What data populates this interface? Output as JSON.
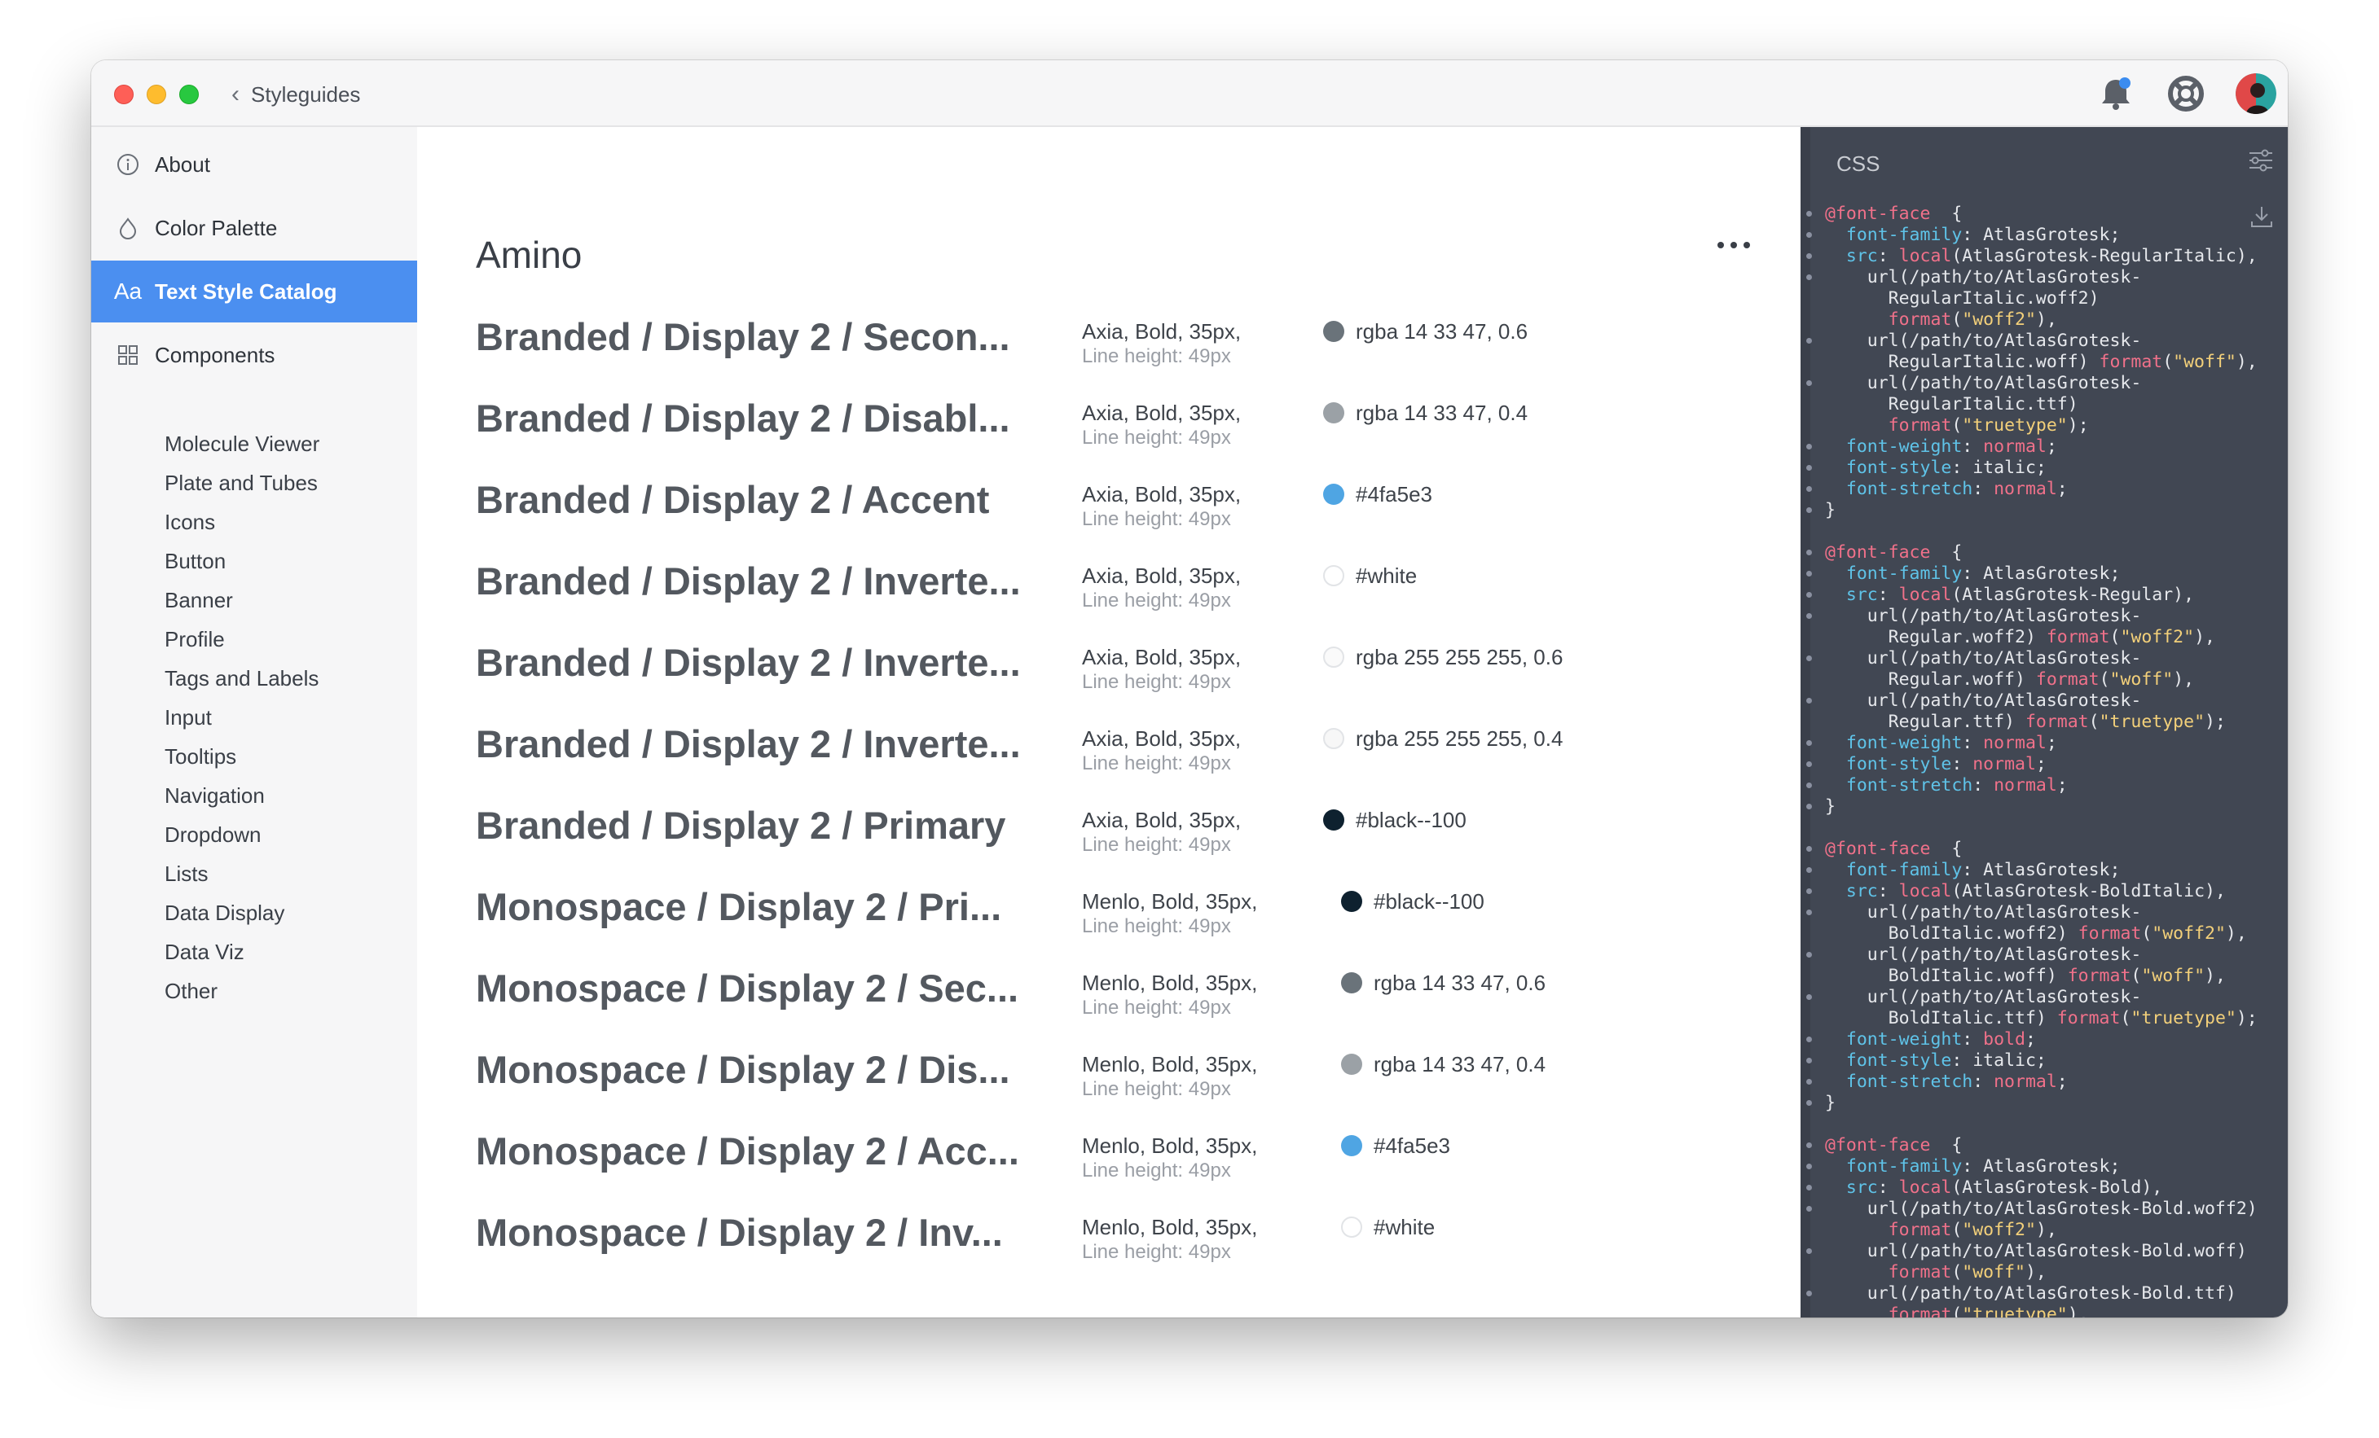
{
  "titlebar": {
    "back_label": "Styleguides",
    "icons": [
      "bell-icon",
      "help-lifebuoy-icon",
      "user-avatar"
    ]
  },
  "sidebar": {
    "top_items": [
      {
        "label": "About",
        "icon": "info-circle-icon",
        "active": false
      },
      {
        "label": "Color Palette",
        "icon": "drop-icon",
        "active": false
      },
      {
        "label": "Text Style Catalog",
        "icon": "text-aa-icon",
        "active": true
      },
      {
        "label": "Components",
        "icon": "grid-icon",
        "active": false
      }
    ],
    "components": [
      "Molecule Viewer",
      "Plate and Tubes",
      "Icons",
      "Button",
      "Banner",
      "Profile",
      "Tags and Labels",
      "Input",
      "Tooltips",
      "Navigation",
      "Dropdown",
      "Lists",
      "Data Display",
      "Data Viz",
      "Other"
    ]
  },
  "main": {
    "title": "Amino",
    "rows": [
      {
        "name": "Branded / Display 2 / Secon...",
        "props": "Axia, Bold, 35px,",
        "line_height": "Line height: 49px",
        "color": "rgba 14 33 47, 0.6",
        "swatch": "#6a737a"
      },
      {
        "name": "Branded / Display 2 / Disabl...",
        "props": "Axia, Bold, 35px,",
        "line_height": "Line height: 49px",
        "color": "rgba 14 33 47, 0.4",
        "swatch": "#9ba1a6"
      },
      {
        "name": "Branded / Display 2 / Accent",
        "props": "Axia, Bold, 35px,",
        "line_height": "Line height: 49px",
        "color": "#4fa5e3",
        "swatch": "#4fa5e3"
      },
      {
        "name": "Branded / Display 2 / Inverte...",
        "props": "Axia, Bold, 35px,",
        "line_height": "Line height: 49px",
        "color": "#white",
        "swatch": "#ffffff"
      },
      {
        "name": "Branded / Display 2 / Inverte...",
        "props": "Axia, Bold, 35px,",
        "line_height": "Line height: 49px",
        "color": "rgba 255 255 255, 0.6",
        "swatch": "#fafafa"
      },
      {
        "name": "Branded / Display 2 / Inverte...",
        "props": "Axia, Bold, 35px,",
        "line_height": "Line height: 49px",
        "color": "rgba 255 255 255, 0.4",
        "swatch": "#f7f7f7"
      },
      {
        "name": "Branded  / Display 2 / Primary",
        "props": "Axia, Bold, 35px,",
        "line_height": "Line height: 49px",
        "color": "#black--100",
        "swatch": "#0e212f"
      },
      {
        "name": "Monospace  / Display 2 / Pri...",
        "props": "Menlo, Bold, 35px,",
        "line_height": "Line height: 49px",
        "color": "#black--100",
        "swatch": "#0e212f"
      },
      {
        "name": "Monospace / Display 2 / Sec...",
        "props": "Menlo, Bold, 35px,",
        "line_height": "Line height: 49px",
        "color": "rgba 14 33 47, 0.6",
        "swatch": "#6a737a"
      },
      {
        "name": "Monospace / Display 2 / Dis...",
        "props": "Menlo, Bold, 35px,",
        "line_height": "Line height: 49px",
        "color": "rgba 14 33 47, 0.4",
        "swatch": "#9ba1a6"
      },
      {
        "name": "Monospace / Display 2 / Acc...",
        "props": "Menlo, Bold, 35px,",
        "line_height": "Line height: 49px",
        "color": "#4fa5e3",
        "swatch": "#4fa5e3"
      },
      {
        "name": "Monospace / Display 2 / Inv...",
        "props": "Menlo, Bold, 35px,",
        "line_height": "Line height: 49px",
        "color": "#white",
        "swatch": "#ffffff"
      }
    ]
  },
  "code_panel": {
    "title": "CSS",
    "lines": [
      [
        [
          "k",
          "@font-face"
        ],
        [
          "",
          "  {"
        ]
      ],
      [
        [
          "p",
          "  font-family"
        ],
        [
          "",
          ": AtlasGrotesk;"
        ]
      ],
      [
        [
          "p",
          "  src"
        ],
        [
          "",
          ": "
        ],
        [
          "k",
          "local"
        ],
        [
          "",
          "(AtlasGrotesk-RegularItalic),"
        ]
      ],
      [
        [
          "",
          "    url(/path/to/AtlasGrotesk-"
        ]
      ],
      [
        [
          "",
          "      RegularItalic.woff2)"
        ]
      ],
      [
        [
          "k",
          "      format"
        ],
        [
          "",
          "("
        ],
        [
          "s",
          "\"woff2\""
        ],
        [
          "",
          "),"
        ]
      ],
      [
        [
          "",
          "    url(/path/to/AtlasGrotesk-"
        ]
      ],
      [
        [
          "",
          "      RegularItalic.woff) "
        ],
        [
          "k",
          "format"
        ],
        [
          "",
          "("
        ],
        [
          "s",
          "\"woff\""
        ],
        [
          "",
          "),"
        ]
      ],
      [
        [
          "",
          "    url(/path/to/AtlasGrotesk-"
        ]
      ],
      [
        [
          "",
          "      RegularItalic.ttf)"
        ]
      ],
      [
        [
          "k",
          "      format"
        ],
        [
          "",
          "("
        ],
        [
          "s",
          "\"truetype\""
        ],
        [
          "",
          ");"
        ]
      ],
      [
        [
          "p",
          "  font-weight"
        ],
        [
          "",
          ": "
        ],
        [
          "k",
          "normal"
        ],
        [
          "",
          ";"
        ]
      ],
      [
        [
          "p",
          "  font-style"
        ],
        [
          "",
          ": italic;"
        ]
      ],
      [
        [
          "p",
          "  font-stretch"
        ],
        [
          "",
          ": "
        ],
        [
          "k",
          "normal"
        ],
        [
          "",
          ";"
        ]
      ],
      [
        [
          "",
          "}"
        ]
      ],
      [
        [
          "",
          ""
        ]
      ],
      [
        [
          "k",
          "@font-face"
        ],
        [
          "",
          "  {"
        ]
      ],
      [
        [
          "p",
          "  font-family"
        ],
        [
          "",
          ": AtlasGrotesk;"
        ]
      ],
      [
        [
          "p",
          "  src"
        ],
        [
          "",
          ": "
        ],
        [
          "k",
          "local"
        ],
        [
          "",
          "(AtlasGrotesk-Regular),"
        ]
      ],
      [
        [
          "",
          "    url(/path/to/AtlasGrotesk-"
        ]
      ],
      [
        [
          "",
          "      Regular.woff2) "
        ],
        [
          "k",
          "format"
        ],
        [
          "",
          "("
        ],
        [
          "s",
          "\"woff2\""
        ],
        [
          "",
          "),"
        ]
      ],
      [
        [
          "",
          "    url(/path/to/AtlasGrotesk-"
        ]
      ],
      [
        [
          "",
          "      Regular.woff) "
        ],
        [
          "k",
          "format"
        ],
        [
          "",
          "("
        ],
        [
          "s",
          "\"woff\""
        ],
        [
          "",
          "),"
        ]
      ],
      [
        [
          "",
          "    url(/path/to/AtlasGrotesk-"
        ]
      ],
      [
        [
          "",
          "      Regular.ttf) "
        ],
        [
          "k",
          "format"
        ],
        [
          "",
          "("
        ],
        [
          "s",
          "\"truetype\""
        ],
        [
          "",
          ");"
        ]
      ],
      [
        [
          "p",
          "  font-weight"
        ],
        [
          "",
          ": "
        ],
        [
          "k",
          "normal"
        ],
        [
          "",
          ";"
        ]
      ],
      [
        [
          "p",
          "  font-style"
        ],
        [
          "",
          ": "
        ],
        [
          "k",
          "normal"
        ],
        [
          "",
          ";"
        ]
      ],
      [
        [
          "p",
          "  font-stretch"
        ],
        [
          "",
          ": "
        ],
        [
          "k",
          "normal"
        ],
        [
          "",
          ";"
        ]
      ],
      [
        [
          "",
          "}"
        ]
      ],
      [
        [
          "",
          ""
        ]
      ],
      [
        [
          "k",
          "@font-face"
        ],
        [
          "",
          "  {"
        ]
      ],
      [
        [
          "p",
          "  font-family"
        ],
        [
          "",
          ": AtlasGrotesk;"
        ]
      ],
      [
        [
          "p",
          "  src"
        ],
        [
          "",
          ": "
        ],
        [
          "k",
          "local"
        ],
        [
          "",
          "(AtlasGrotesk-BoldItalic),"
        ]
      ],
      [
        [
          "",
          "    url(/path/to/AtlasGrotesk-"
        ]
      ],
      [
        [
          "",
          "      BoldItalic.woff2) "
        ],
        [
          "k",
          "format"
        ],
        [
          "",
          "("
        ],
        [
          "s",
          "\"woff2\""
        ],
        [
          "",
          "),"
        ]
      ],
      [
        [
          "",
          "    url(/path/to/AtlasGrotesk-"
        ]
      ],
      [
        [
          "",
          "      BoldItalic.woff) "
        ],
        [
          "k",
          "format"
        ],
        [
          "",
          "("
        ],
        [
          "s",
          "\"woff\""
        ],
        [
          "",
          "),"
        ]
      ],
      [
        [
          "",
          "    url(/path/to/AtlasGrotesk-"
        ]
      ],
      [
        [
          "",
          "      BoldItalic.ttf) "
        ],
        [
          "k",
          "format"
        ],
        [
          "",
          "("
        ],
        [
          "s",
          "\"truetype\""
        ],
        [
          "",
          ");"
        ]
      ],
      [
        [
          "p",
          "  font-weight"
        ],
        [
          "",
          ": "
        ],
        [
          "k",
          "bold"
        ],
        [
          "",
          ";"
        ]
      ],
      [
        [
          "p",
          "  font-style"
        ],
        [
          "",
          ": italic;"
        ]
      ],
      [
        [
          "p",
          "  font-stretch"
        ],
        [
          "",
          ": "
        ],
        [
          "k",
          "normal"
        ],
        [
          "",
          ";"
        ]
      ],
      [
        [
          "",
          "}"
        ]
      ],
      [
        [
          "",
          ""
        ]
      ],
      [
        [
          "k",
          "@font-face"
        ],
        [
          "",
          "  {"
        ]
      ],
      [
        [
          "p",
          "  font-family"
        ],
        [
          "",
          ": AtlasGrotesk;"
        ]
      ],
      [
        [
          "p",
          "  src"
        ],
        [
          "",
          ": "
        ],
        [
          "k",
          "local"
        ],
        [
          "",
          "(AtlasGrotesk-Bold),"
        ]
      ],
      [
        [
          "",
          "    url(/path/to/AtlasGrotesk-Bold.woff2)"
        ]
      ],
      [
        [
          "k",
          "      format"
        ],
        [
          "",
          "("
        ],
        [
          "s",
          "\"woff2\""
        ],
        [
          "",
          "),"
        ]
      ],
      [
        [
          "",
          "    url(/path/to/AtlasGrotesk-Bold.woff)"
        ]
      ],
      [
        [
          "k",
          "      format"
        ],
        [
          "",
          "("
        ],
        [
          "s",
          "\"woff\""
        ],
        [
          "",
          "),"
        ]
      ],
      [
        [
          "",
          "    url(/path/to/AtlasGrotesk-Bold.ttf)"
        ]
      ],
      [
        [
          "k",
          "      format"
        ],
        [
          "",
          "("
        ],
        [
          "s",
          "\"truetype\""
        ],
        [
          "",
          "),"
        ]
      ]
    ],
    "dotted_lines": [
      0,
      1,
      2,
      3,
      6,
      8,
      11,
      12,
      13,
      14,
      16,
      17,
      18,
      19,
      21,
      23,
      25,
      26,
      27,
      28,
      30,
      31,
      32,
      33,
      35,
      37,
      39,
      40,
      41,
      42,
      44,
      45,
      46,
      47,
      49,
      51
    ]
  }
}
